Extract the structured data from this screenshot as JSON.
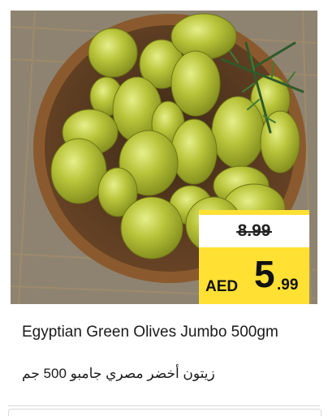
{
  "product": {
    "title_en": "Egyptian Green Olives Jumbo 500gm",
    "title_ar": "زيتون أخضر مصري جامبو 500 جم",
    "image_alt": "olives-in-wooden-bowl"
  },
  "price": {
    "old": "8.99",
    "currency": "AED",
    "new_int": "5",
    "new_dec": ".99"
  },
  "colors": {
    "badge": "#ffe033",
    "olive": "#a8b62c",
    "bowl": "#8a5a2e"
  }
}
